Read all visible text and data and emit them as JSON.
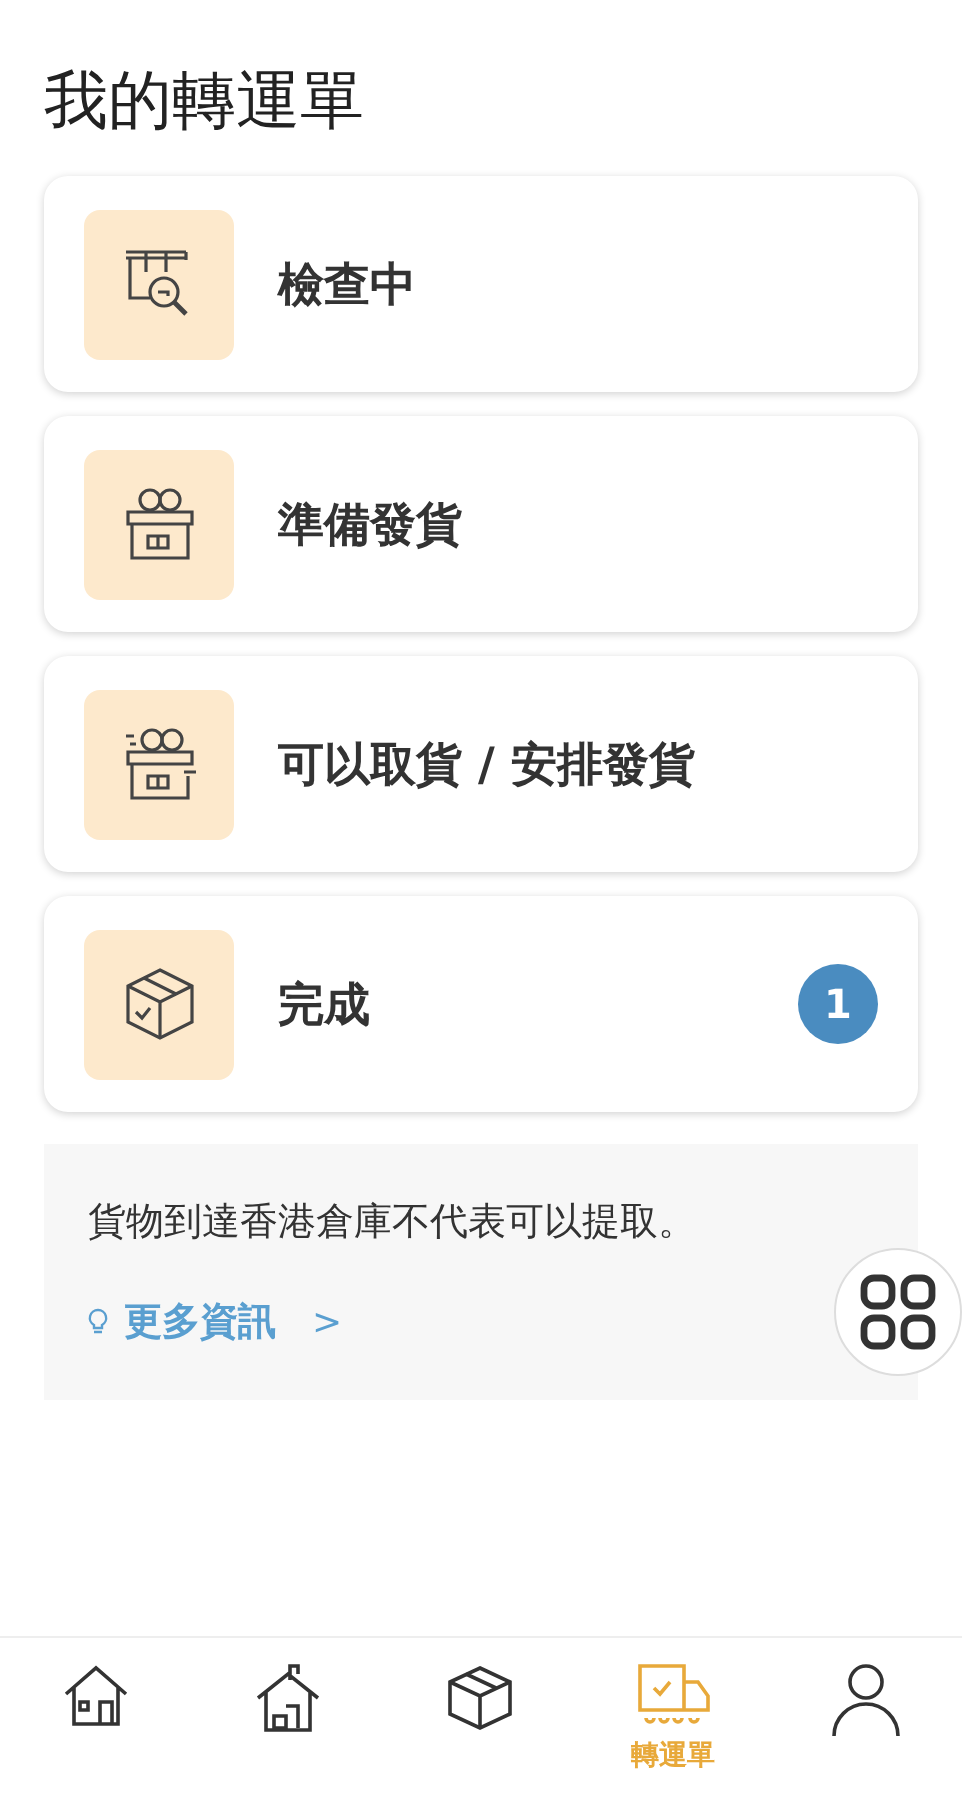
{
  "page": {
    "title": "我的轉運單"
  },
  "statuses": [
    {
      "kind": "inspecting",
      "label": "檢查中"
    },
    {
      "kind": "preparing",
      "label": "準備發貨"
    },
    {
      "kind": "ready",
      "label": "可以取貨 / 安排發貨"
    },
    {
      "kind": "done",
      "label": "完成",
      "badge": "1"
    }
  ],
  "notice": {
    "text": "貨物到達香港倉庫不代表可以提取。",
    "link": "更多資訊",
    "chevron": ">"
  },
  "bottom_nav": [
    {
      "kind": "home",
      "selected": false
    },
    {
      "kind": "warehouse",
      "selected": false
    },
    {
      "kind": "parcel",
      "selected": false
    },
    {
      "kind": "forwarding",
      "selected": true,
      "label": "轉運單"
    },
    {
      "kind": "profile",
      "selected": false
    }
  ]
}
